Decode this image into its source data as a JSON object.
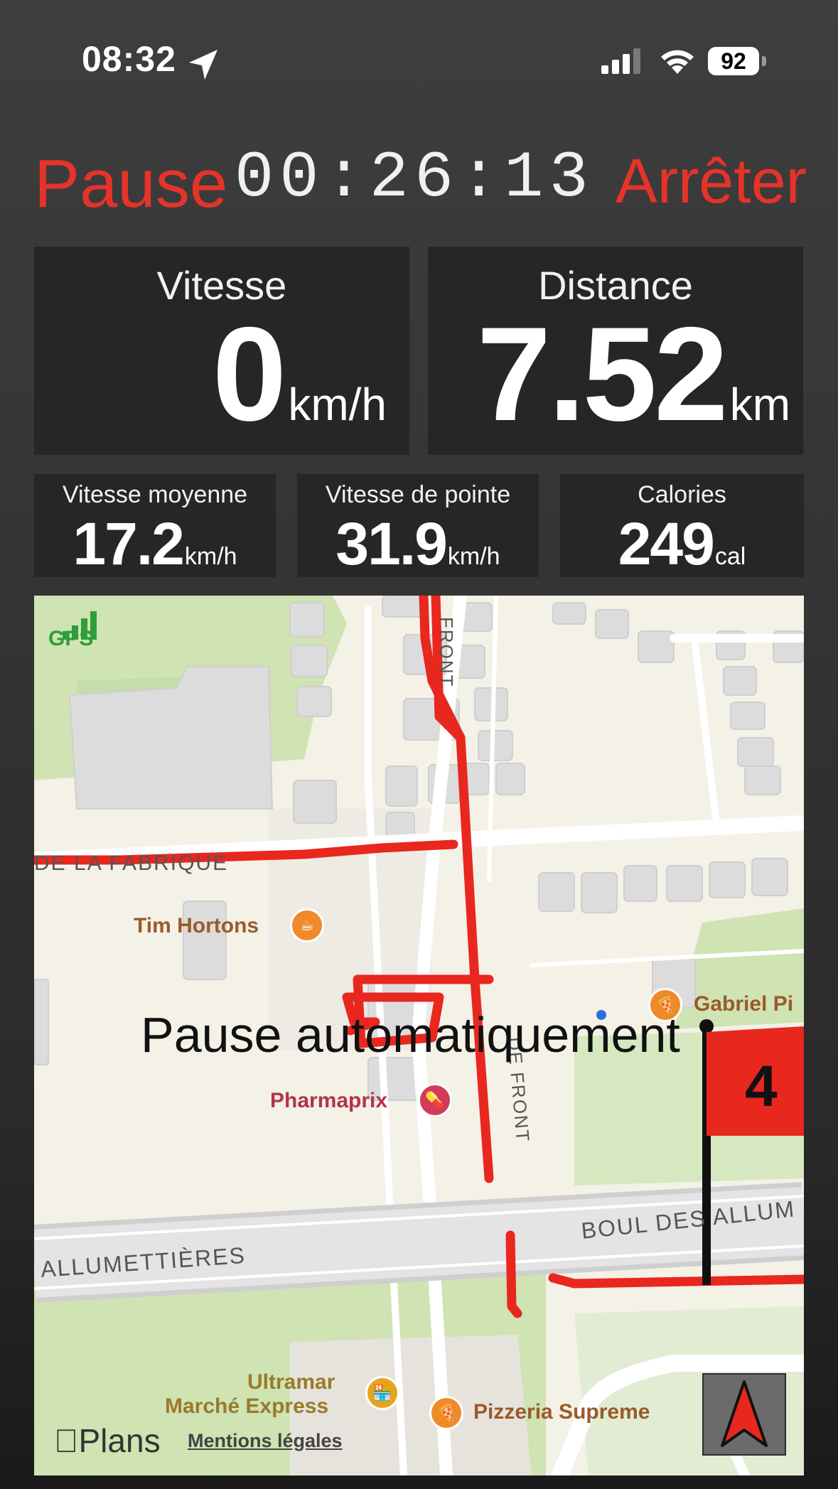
{
  "status_bar": {
    "time": "08:32",
    "battery": "92",
    "icons": [
      "location-arrow-icon",
      "cellular-signal-icon",
      "wifi-icon",
      "battery-icon"
    ]
  },
  "controls": {
    "pause_label": "Pause",
    "timer": "00:26:13",
    "stop_label": "Arrêter"
  },
  "stats": {
    "speed": {
      "title": "Vitesse",
      "value": "0",
      "unit": "km/h"
    },
    "distance": {
      "title": "Distance",
      "value": "7.52",
      "unit": "km"
    },
    "avg_speed": {
      "title": "Vitesse moyenne",
      "value": "17.2",
      "unit": "km/h"
    },
    "max_speed": {
      "title": "Vitesse de pointe",
      "value": "31.9",
      "unit": "km/h"
    },
    "calories": {
      "title": "Calories",
      "value": "249",
      "unit": "cal"
    }
  },
  "map": {
    "gps_label": "GPS",
    "auto_pause_text": "Pause automatiquement",
    "flag_number": "4",
    "streets": {
      "fabrique": "DE LA FABRIQUE",
      "front_top": "FRONT",
      "front_mid": "DE FRONT",
      "boul_right": "BOUL DES ALLUM",
      "allumettieres_left": "ALLUMETTIÈRES"
    },
    "pois": {
      "tim": "Tim Hortons",
      "pharma": "Pharmaprix",
      "gabriel": "Gabriel Pi",
      "ultramar_1": "Ultramar",
      "ultramar_2": "Marché Express",
      "pizzeria": "Pizzeria Supreme"
    },
    "attribution": "Plans",
    "legal": "Mentions légales",
    "route_color": "#e8271e",
    "accent_red": "#e63329"
  }
}
